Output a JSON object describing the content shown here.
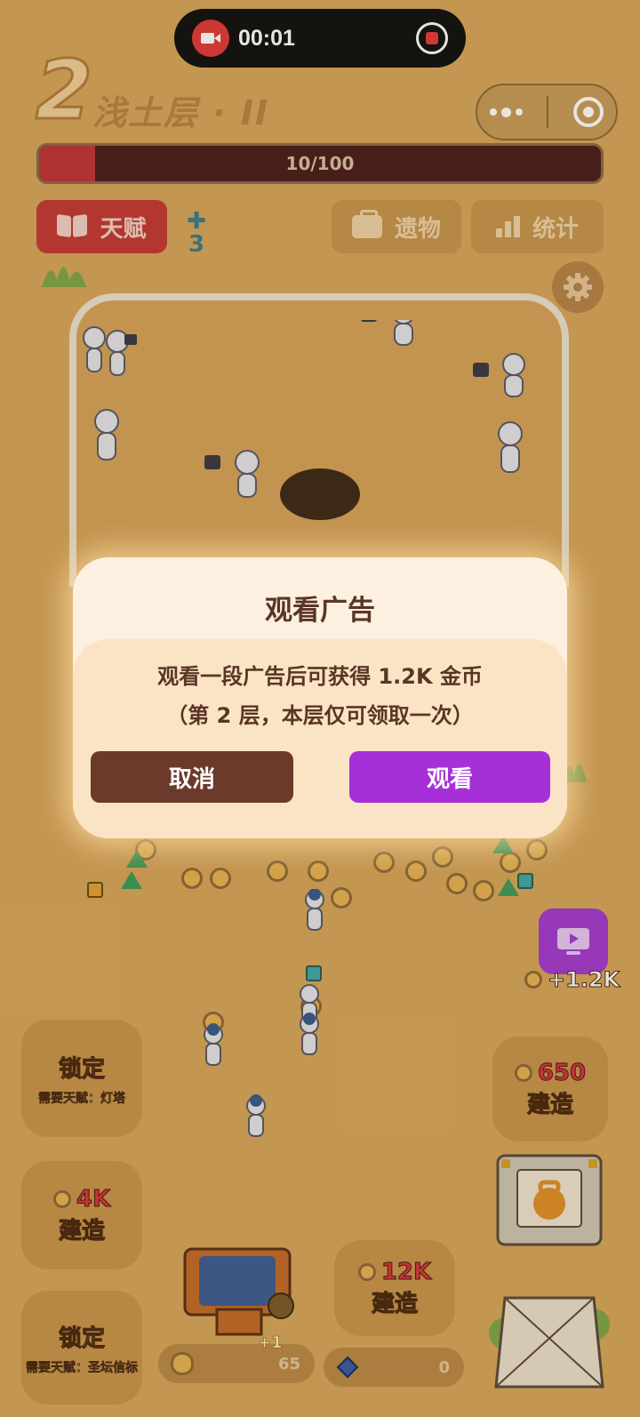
{
  "recorder": {
    "time": "00:01"
  },
  "header": {
    "level_number": "2",
    "level_name": "浅土层 · II"
  },
  "progress": {
    "text": "10/100",
    "current": 10,
    "max": 100
  },
  "toolbar": {
    "talent_label": "天赋",
    "talent_points": "3",
    "relic_label": "遗物",
    "stats_label": "统计"
  },
  "ad_badge": {
    "reward": "+1.2K"
  },
  "slots": {
    "left_top": {
      "main": "锁定",
      "sub": "需要天赋：灯塔"
    },
    "left_mid": {
      "cost": "4K",
      "main": "建造"
    },
    "left_bottom": {
      "main": "锁定",
      "sub": "需要天赋：圣坛信标"
    },
    "center": {
      "cost": "12K",
      "main": "建造"
    },
    "right_top": {
      "cost": "650",
      "main": "建造"
    }
  },
  "counters": {
    "coins": {
      "value": "65",
      "plus": "+1"
    },
    "gems": {
      "value": "0"
    }
  },
  "modal": {
    "title": "观看广告",
    "line1": "观看一段广告后可获得 1.2K 金币",
    "line2": "（第 2 层，本层仅可领取一次）",
    "cancel_label": "取消",
    "watch_label": "观看"
  },
  "colors": {
    "background": "#d7a65c",
    "accent_red": "#c43a36",
    "accent_purple": "#a530d8",
    "modal_text": "#5a3526"
  }
}
